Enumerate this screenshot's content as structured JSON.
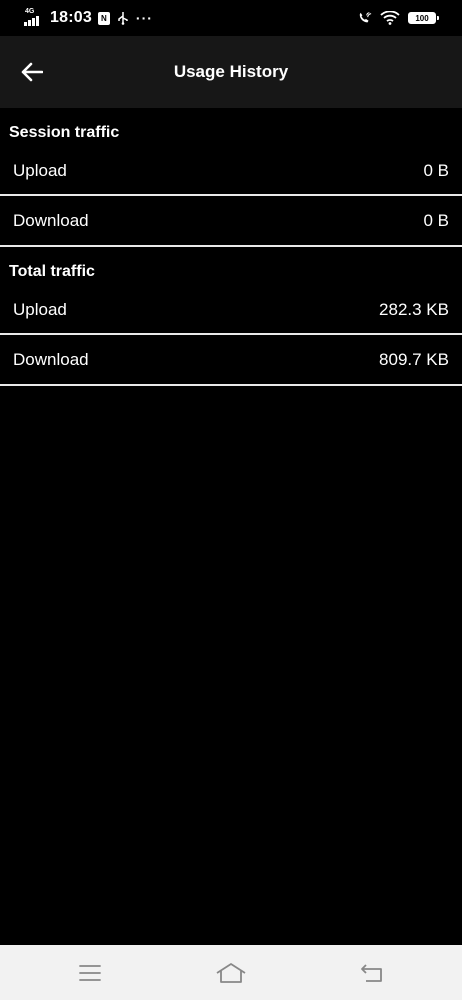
{
  "status_bar": {
    "network_type": "4G",
    "time": "18:03",
    "notification_badge": "N",
    "more_indicator": "···",
    "battery_level": "100"
  },
  "app_bar": {
    "title": "Usage History"
  },
  "sections": [
    {
      "title": "Session traffic",
      "rows": [
        {
          "label": "Upload",
          "value": "0 B"
        },
        {
          "label": "Download",
          "value": "0 B"
        }
      ]
    },
    {
      "title": "Total traffic",
      "rows": [
        {
          "label": "Upload",
          "value": "282.3 KB"
        },
        {
          "label": "Download",
          "value": "809.7 KB"
        }
      ]
    }
  ],
  "colors": {
    "background": "#000000",
    "app_bar_background": "#171717",
    "divider": "#e9e9e9",
    "text": "#ffffff",
    "nav_bar_background": "#f2f2f2",
    "nav_icon": "#888888"
  },
  "icons": {
    "back": "arrow-left-icon",
    "usb": "usb-icon",
    "wifi_call": "wifi-call-icon",
    "wifi": "wifi-icon",
    "battery": "battery-icon",
    "nav_menu": "menu-icon",
    "nav_home": "home-icon",
    "nav_back": "return-icon"
  }
}
